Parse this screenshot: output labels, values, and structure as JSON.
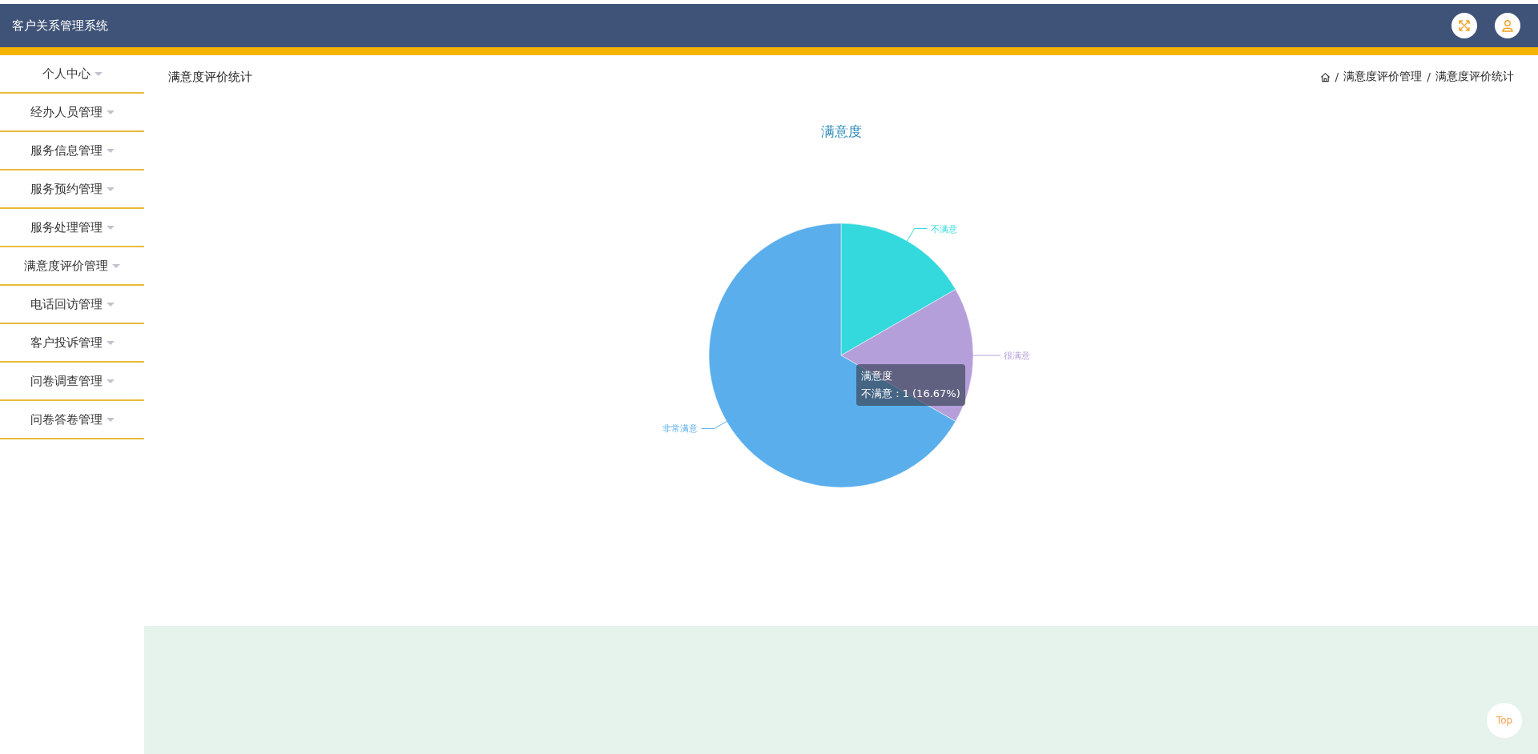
{
  "header": {
    "title": "客户关系管理系统"
  },
  "sidebar": {
    "items": [
      {
        "label": "个人中心"
      },
      {
        "label": "经办人员管理"
      },
      {
        "label": "服务信息管理"
      },
      {
        "label": "服务预约管理"
      },
      {
        "label": "服务处理管理"
      },
      {
        "label": "满意度评价管理"
      },
      {
        "label": "电话回访管理"
      },
      {
        "label": "客户投诉管理"
      },
      {
        "label": "问卷调查管理"
      },
      {
        "label": "问卷答卷管理"
      }
    ]
  },
  "page_title": "满意度评价统计",
  "breadcrumb": {
    "separator": "/",
    "items": [
      "满意度评价管理",
      "满意度评价统计"
    ]
  },
  "chart": {
    "tooltip": {
      "line": "不满意 : 1 (16.67%)"
    },
    "chart_data": {
      "type": "pie",
      "title": "满意度",
      "categories": [
        "不满意",
        "很满意",
        "非常满意"
      ],
      "series": [
        {
          "name": "满意度",
          "values": [
            16.67,
            16.67,
            66.66
          ]
        }
      ],
      "colors": [
        "#33d9dc",
        "#b59fda",
        "#5aaeec"
      ]
    }
  },
  "top_button": "Top"
}
